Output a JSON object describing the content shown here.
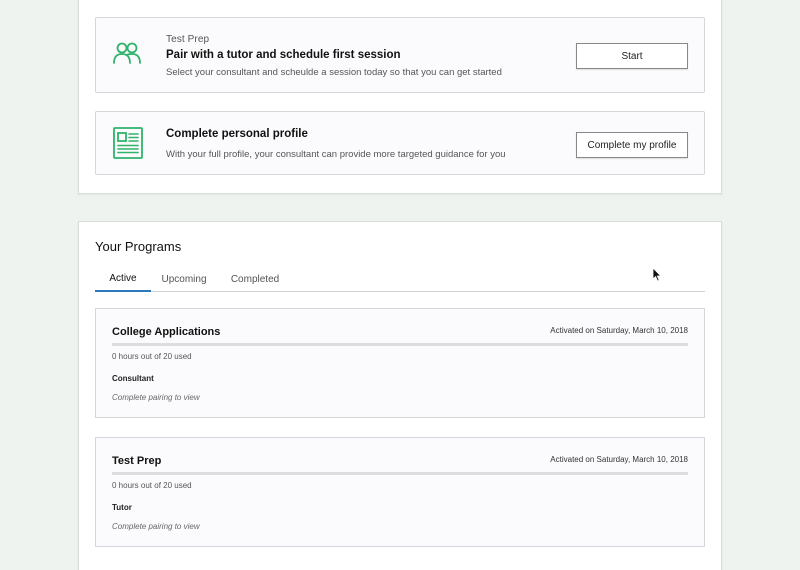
{
  "tasks": [
    {
      "eyebrow": "Test Prep",
      "title": "Pair with a tutor and schedule first session",
      "description": "Select your consultant and scheulde a session today so that you can get started",
      "button_label": "Start",
      "icon": "users-icon"
    },
    {
      "eyebrow": "",
      "title": "Complete personal profile",
      "description": "With your full profile, your consultant can provide more targeted guidance for you",
      "button_label": "Complete my profile",
      "icon": "profile-document-icon"
    }
  ],
  "programs": {
    "title": "Your Programs",
    "tabs": [
      {
        "label": "Active",
        "active": true
      },
      {
        "label": "Upcoming",
        "active": false
      },
      {
        "label": "Completed",
        "active": false
      }
    ],
    "items": [
      {
        "name": "College Applications",
        "activated": "Activated on Saturday, March 10, 2018",
        "usage": "0 hours out of 20 used",
        "used_hours": 0,
        "total_hours": 20,
        "role": "Consultant",
        "note": "Complete pairing to view"
      },
      {
        "name": "Test Prep",
        "activated": "Activated on Saturday, March 10, 2018",
        "usage": "0 hours out of 20 used",
        "used_hours": 0,
        "total_hours": 20,
        "role": "Tutor",
        "note": "Complete pairing to view"
      }
    ]
  },
  "colors": {
    "icon_green": "#2fb36a",
    "active_tab_underline": "#2b7bbd",
    "background": "#eef3ef"
  }
}
